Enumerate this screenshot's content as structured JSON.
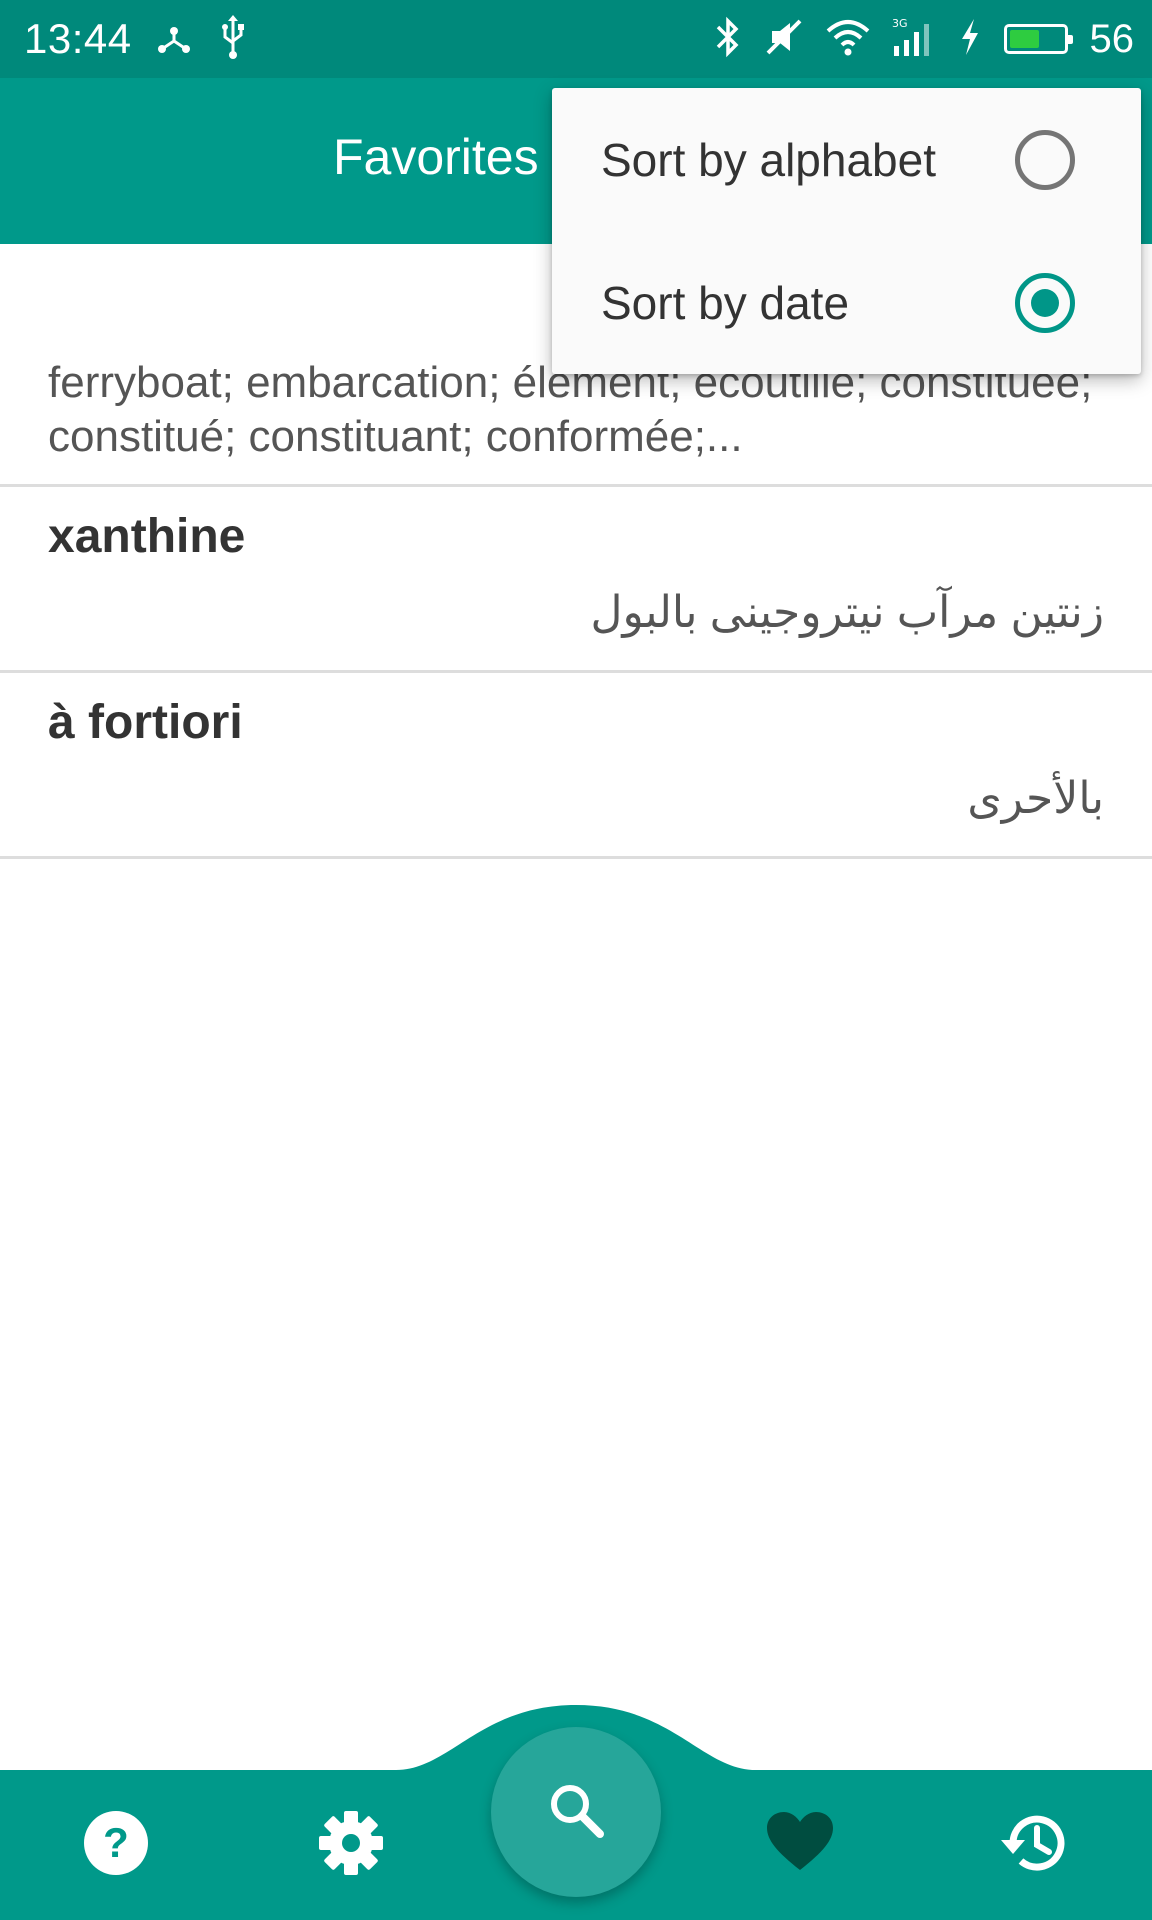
{
  "status_bar": {
    "time": "13:44",
    "battery_percent": "56",
    "battery_fill_fraction": 0.56,
    "left_icons": [
      "share-icon",
      "usb-icon"
    ],
    "right_icons": [
      "bluetooth-icon",
      "mute-icon",
      "wifi-icon",
      "signal-3g-icon",
      "charging-icon",
      "battery-icon"
    ]
  },
  "app_bar": {
    "title": "Favorites"
  },
  "sort_menu": {
    "items": [
      {
        "label": "Sort by alphabet",
        "checked": false
      },
      {
        "label": "Sort by date",
        "checked": true
      }
    ]
  },
  "favorites": [
    {
      "title": "",
      "desc": "ferryboat; embarcation; élément; écoutille; constituée; constitué; constituant; conformée;..."
    },
    {
      "title": "xanthine",
      "desc": "زنتین مرآب نیتروجینی بالبول"
    },
    {
      "title": "à fortiori",
      "desc": "بالأحرى"
    }
  ],
  "bottom_nav": {
    "items": [
      "help-icon",
      "settings-icon",
      "search-icon",
      "favorites-heart-icon",
      "history-icon"
    ],
    "active": "favorites-heart-icon"
  },
  "colors": {
    "primary": "#00998a",
    "status_bar": "#00897b",
    "accent": "#009688",
    "fab": "#26a69a",
    "active_icon": "#004d40"
  }
}
